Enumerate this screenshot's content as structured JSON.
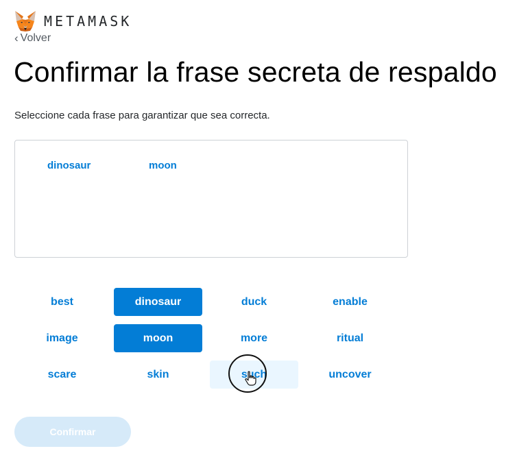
{
  "header": {
    "brand": "METAMASK",
    "logo_icon": "fox-icon"
  },
  "nav": {
    "back_chevron": "‹",
    "back_label": "Volver"
  },
  "page": {
    "title": "Confirmar la frase secreta de respaldo",
    "subtitle": "Seleccione cada frase para garantizar que sea correcta."
  },
  "selected_words": [
    "dinosaur",
    "moon"
  ],
  "word_grid": [
    {
      "word": "best",
      "state": "normal"
    },
    {
      "word": "dinosaur",
      "state": "selected"
    },
    {
      "word": "duck",
      "state": "normal"
    },
    {
      "word": "enable",
      "state": "normal"
    },
    {
      "word": "image",
      "state": "normal"
    },
    {
      "word": "moon",
      "state": "selected"
    },
    {
      "word": "more",
      "state": "normal"
    },
    {
      "word": "ritual",
      "state": "normal"
    },
    {
      "word": "scare",
      "state": "normal"
    },
    {
      "word": "skin",
      "state": "normal"
    },
    {
      "word": "such",
      "state": "hover"
    },
    {
      "word": "uncover",
      "state": "normal"
    }
  ],
  "confirm_button": {
    "label": "Confirmar",
    "state": "disabled"
  },
  "colors": {
    "accent": "#037dd6",
    "hover_bg": "#eaf6ff",
    "disabled_button_bg": "#d6eaf9",
    "border": "#cdd1d6"
  }
}
